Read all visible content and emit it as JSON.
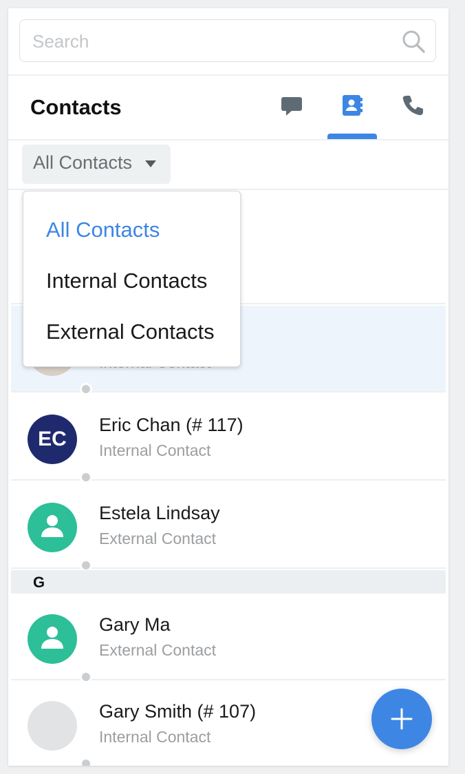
{
  "search": {
    "placeholder": "Search"
  },
  "header": {
    "title": "Contacts",
    "tabs": [
      {
        "name": "messages",
        "icon": "chat-bubble-icon",
        "active": false
      },
      {
        "name": "contacts",
        "icon": "contact-book-icon",
        "active": true
      },
      {
        "name": "calls",
        "icon": "phone-icon",
        "active": false
      }
    ]
  },
  "filter": {
    "selected": "All Contacts",
    "options": [
      "All Contacts",
      "Internal Contacts",
      "External Contacts"
    ]
  },
  "contacts": [
    {
      "name": "",
      "type": "Internal Contact",
      "avatar": "photo",
      "selected": true
    },
    {
      "name": "Eric Chan (# 117)",
      "type": "Internal Contact",
      "initials": "EC",
      "avatar_color": "#1f2a6e"
    },
    {
      "name": "Estela Lindsay",
      "type": "External Contact",
      "avatar": "person-icon",
      "avatar_color": "#2dbf98"
    }
  ],
  "section": {
    "label": "G"
  },
  "contacts_g": [
    {
      "name": "Gary Ma",
      "type": "External Contact",
      "avatar": "person-icon",
      "avatar_color": "#2dbf98"
    },
    {
      "name": "Gary Smith (# 107)",
      "type": "Internal Contact",
      "avatar": "placeholder",
      "avatar_color": "#e2e3e4"
    }
  ],
  "colors": {
    "accent": "#3d86e4",
    "presence_offline": "#cbced1"
  }
}
